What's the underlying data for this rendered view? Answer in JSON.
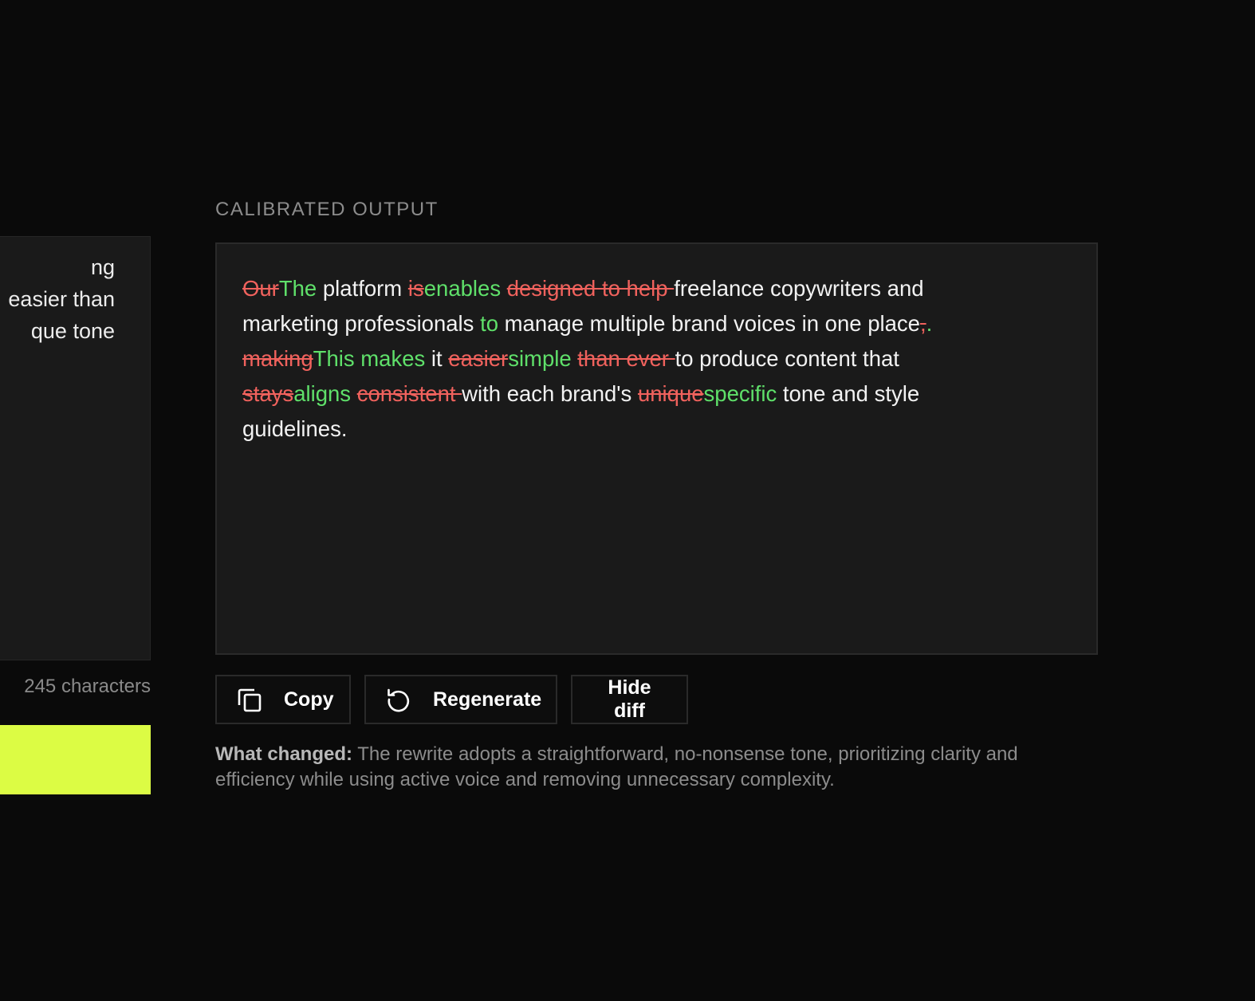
{
  "input": {
    "text_lines": [
      "ng",
      "easier than",
      "que tone"
    ],
    "char_count": "245 characters"
  },
  "output": {
    "section_label": "CALIBRATED OUTPUT",
    "diff": [
      {
        "t": "del",
        "s": "Our"
      },
      {
        "t": "ins",
        "s": "The"
      },
      {
        "t": "eq",
        "s": " platform "
      },
      {
        "t": "del",
        "s": "is"
      },
      {
        "t": "ins",
        "s": "enables"
      },
      {
        "t": "eq",
        "s": " "
      },
      {
        "t": "del",
        "s": "designed to help "
      },
      {
        "t": "eq",
        "s": "freelance copywriters and marketing professionals "
      },
      {
        "t": "ins",
        "s": "to"
      },
      {
        "t": "eq",
        "s": " manage multiple brand voices in one place"
      },
      {
        "t": "del",
        "s": ","
      },
      {
        "t": "ins",
        "s": "."
      },
      {
        "t": "eq",
        "s": " "
      },
      {
        "t": "del",
        "s": "making"
      },
      {
        "t": "ins",
        "s": "This makes"
      },
      {
        "t": "eq",
        "s": " it "
      },
      {
        "t": "del",
        "s": "easier"
      },
      {
        "t": "ins",
        "s": "simple"
      },
      {
        "t": "eq",
        "s": " "
      },
      {
        "t": "del",
        "s": "than ever "
      },
      {
        "t": "eq",
        "s": "to produce content that "
      },
      {
        "t": "del",
        "s": "stays"
      },
      {
        "t": "ins",
        "s": "aligns"
      },
      {
        "t": "eq",
        "s": " "
      },
      {
        "t": "del",
        "s": "consistent "
      },
      {
        "t": "eq",
        "s": "with each brand's "
      },
      {
        "t": "del",
        "s": "unique"
      },
      {
        "t": "ins",
        "s": "specific"
      },
      {
        "t": "eq",
        "s": " tone and style guidelines."
      }
    ]
  },
  "actions": {
    "copy_label": "Copy",
    "regenerate_label": "Regenerate",
    "hide_diff_label": "Hide diff",
    "copy_icon": "copy-icon",
    "regenerate_icon": "refresh-icon"
  },
  "changes": {
    "lead": "What changed:",
    "text": " The rewrite adopts a straightforward, no-nonsense tone, prioritizing clarity and efficiency while using active voice and removing unnecessary complexity."
  },
  "colors": {
    "background": "#0a0a0a",
    "panel": "#1a1a1a",
    "deleted": "#f0625d",
    "inserted": "#5fe06a",
    "accent": "#dcfc44"
  }
}
